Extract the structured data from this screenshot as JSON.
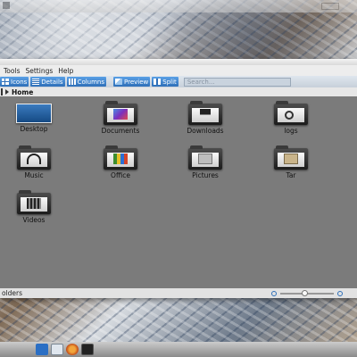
{
  "menu": [
    "Tools",
    "Settings",
    "Help"
  ],
  "toolbar": {
    "icons_label": "Icons",
    "details_label": "Details",
    "columns_label": "Columns",
    "preview_label": "Preview",
    "split_label": "Split",
    "search_placeholder": "Search..."
  },
  "location": {
    "crumb": "Home"
  },
  "items": [
    {
      "label": "Desktop",
      "icon": "desktop-folder-icon"
    },
    {
      "label": "Documents",
      "icon": "documents-folder-icon"
    },
    {
      "label": "Downloads",
      "icon": "downloads-folder-icon"
    },
    {
      "label": "logs",
      "icon": "logs-folder-icon"
    },
    {
      "label": "Music",
      "icon": "music-folder-icon"
    },
    {
      "label": "Office",
      "icon": "office-folder-icon"
    },
    {
      "label": "Pictures",
      "icon": "pictures-folder-icon"
    },
    {
      "label": "Tar",
      "icon": "tar-folder-icon"
    },
    {
      "label": "Videos",
      "icon": "videos-folder-icon"
    }
  ],
  "status": {
    "text": "olders",
    "zoom_fraction": 0.4
  },
  "colors": {
    "accent": "#2e6fb8",
    "content_bg": "#7b7b7b"
  }
}
